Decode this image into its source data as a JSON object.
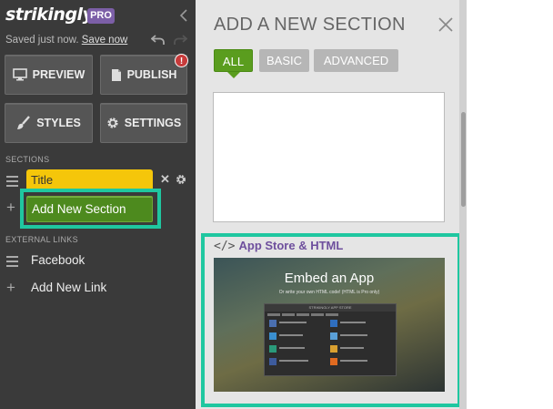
{
  "brand": {
    "logo_text": "strikingly",
    "pro_badge": "PRO"
  },
  "status": {
    "saved_text": "Saved just now.",
    "save_link": "Save now"
  },
  "toolbar": {
    "preview_label": "PREVIEW",
    "publish_label": "PUBLISH",
    "publish_alert": "!",
    "styles_label": "STYLES",
    "settings_label": "SETTINGS"
  },
  "sections": {
    "heading": "SECTIONS",
    "items": [
      {
        "label": "Title"
      }
    ],
    "add_label": "Add New Section"
  },
  "external_links": {
    "heading": "EXTERNAL LINKS",
    "items": [
      {
        "label": "Facebook"
      }
    ],
    "add_label": "Add New Link"
  },
  "panel": {
    "title": "ADD A NEW SECTION",
    "tabs": [
      {
        "label": "ALL",
        "active": true
      },
      {
        "label": "BASIC",
        "active": false
      },
      {
        "label": "ADVANCED",
        "active": false
      }
    ],
    "app_section": {
      "label_prefix": "</>",
      "label": "App Store & HTML",
      "preview_title": "Embed an App",
      "preview_subtitle": "Or write your own HTML code! (HTML is Pro only)",
      "preview_window_title": "STRIKINGLY APP STORE"
    }
  },
  "colors": {
    "sidebar_bg": "#3a3a3a",
    "accent_green": "#5a9d1e",
    "highlight_teal": "#1fc7a0",
    "title_yellow": "#f5c60a",
    "pro_purple": "#7c5fa7"
  }
}
